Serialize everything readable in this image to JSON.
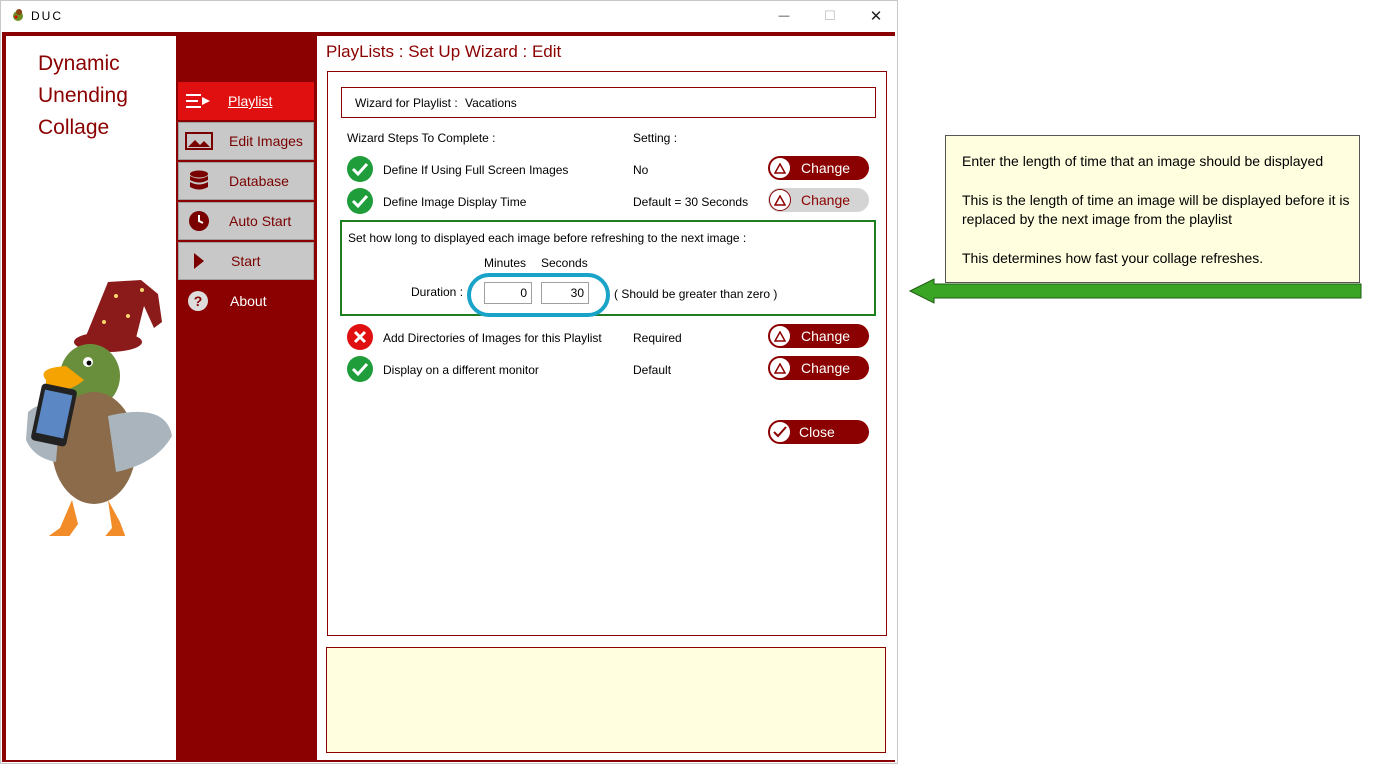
{
  "window": {
    "title": "DUC",
    "minimize_glyph": "—",
    "maximize_glyph": "☐",
    "close_glyph": "✕"
  },
  "brand": {
    "line1": "Dynamic",
    "line2": "Unending",
    "line3": "Collage"
  },
  "nav": {
    "items": [
      {
        "label": "Playlist",
        "icon": "list-arrow-icon",
        "state": "active"
      },
      {
        "label": "Edit Images",
        "icon": "image-icon",
        "state": "grey"
      },
      {
        "label": "Database",
        "icon": "database-icon",
        "state": "grey"
      },
      {
        "label": "Auto Start",
        "icon": "clock-icon",
        "state": "grey"
      },
      {
        "label": "Start",
        "icon": "play-icon",
        "state": "grey"
      },
      {
        "label": "About",
        "icon": "question-icon",
        "state": "plain"
      }
    ]
  },
  "page": {
    "title": "PlayLists : Set Up Wizard : Edit"
  },
  "wizard": {
    "playlist_label": "Wizard for Playlist :",
    "playlist_name": "Vacations",
    "steps_header": "Wizard Steps To Complete :",
    "setting_header": "Setting :",
    "steps": [
      {
        "label": "Define If Using Full Screen Images",
        "setting": "No",
        "status": "complete",
        "button": "Change",
        "button_state": "enabled"
      },
      {
        "label": "Define Image Display Time",
        "setting": "Default = 30 Seconds",
        "status": "complete",
        "button": "Change",
        "button_state": "active"
      },
      {
        "label": "Add Directories of Images for this Playlist",
        "setting": "Required",
        "status": "incomplete",
        "button": "Change",
        "button_state": "enabled"
      },
      {
        "label": "Display on a different monitor",
        "setting": "Default",
        "status": "complete",
        "button": "Change",
        "button_state": "enabled"
      }
    ],
    "duration_panel": {
      "instruction": "Set how long to displayed each image before refreshing to the next image :",
      "minutes_label": "Minutes",
      "seconds_label": "Seconds",
      "duration_label": "Duration :",
      "minutes_value": "0",
      "seconds_value": "30",
      "hint": "( Should be greater than zero )"
    },
    "close_label": "Close"
  },
  "callout": {
    "line1": "Enter the length of time that an image should  be displayed",
    "line2": "This is the length of time an image will be displayed before it is replaced by the next image from the playlist",
    "line3": "This determines how fast your collage refreshes."
  },
  "colors": {
    "brand_red": "#8b0000",
    "active_nav": "#e01010",
    "check_green": "#1f9d3a",
    "error_red": "#e01010",
    "highlight_cyan": "#1aa3c8",
    "arrow_green": "#3aa524"
  }
}
